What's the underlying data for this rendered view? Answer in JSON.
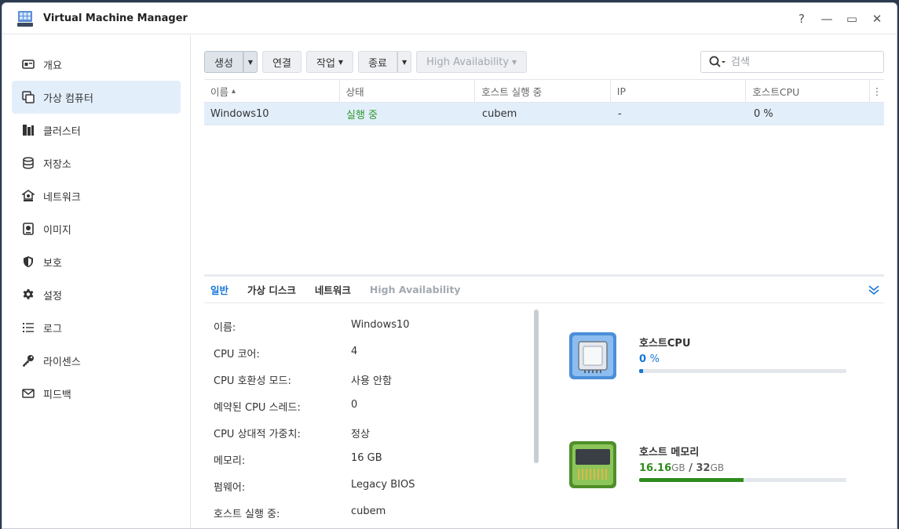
{
  "app": {
    "title": "Virtual Machine Manager"
  },
  "window_controls": {
    "help": "?",
    "minimize": "—",
    "maximize": "▭",
    "close": "✕"
  },
  "sidebar": {
    "items": [
      {
        "label": "개요",
        "icon": "overview-icon"
      },
      {
        "label": "가상 컴퓨터",
        "icon": "virtual-machine-icon",
        "active": true
      },
      {
        "label": "클러스터",
        "icon": "cluster-icon"
      },
      {
        "label": "저장소",
        "icon": "storage-icon"
      },
      {
        "label": "네트워크",
        "icon": "network-icon"
      },
      {
        "label": "이미지",
        "icon": "image-icon"
      },
      {
        "label": "보호",
        "icon": "shield-icon"
      },
      {
        "label": "설정",
        "icon": "gear-icon"
      },
      {
        "label": "로그",
        "icon": "log-list-icon"
      },
      {
        "label": "라이센스",
        "icon": "key-icon"
      },
      {
        "label": "피드백",
        "icon": "mail-icon"
      }
    ]
  },
  "toolbar": {
    "create_label": "생성",
    "connect_label": "연결",
    "action_label": "작업",
    "shutdown_label": "종료",
    "ha_label": "High Availability"
  },
  "search": {
    "placeholder": "검색"
  },
  "grid": {
    "columns": [
      "이름",
      "상태",
      "호스트 실행 중",
      "IP",
      "호스트CPU"
    ],
    "sort_indicator": "▴",
    "more_icon": "⋮",
    "rows": [
      {
        "name": "Windows10",
        "status": "실행 중",
        "host": "cubem",
        "ip": "-",
        "cpu": "0 %"
      }
    ]
  },
  "detail": {
    "tabs": [
      "일반",
      "가상 디스크",
      "네트워크",
      "High Availability"
    ],
    "props": [
      {
        "label": "이름:",
        "value": "Windows10"
      },
      {
        "label": "CPU 코어:",
        "value": "4"
      },
      {
        "label": "CPU 호환성 모드:",
        "value": "사용 안함"
      },
      {
        "label": "예약된 CPU 스레드:",
        "value": "0"
      },
      {
        "label": "CPU 상대적 가중치:",
        "value": "정상"
      },
      {
        "label": "메모리:",
        "value": "16 GB"
      },
      {
        "label": "펌웨어:",
        "value": "Legacy BIOS"
      },
      {
        "label": "호스트 실행 중:",
        "value": "cubem"
      }
    ],
    "host_cpu": {
      "title": "호스트CPU",
      "value": "0",
      "unit": "%",
      "fraction": 0.02,
      "color": "#1677d8"
    },
    "host_memory": {
      "title": "호스트 메모리",
      "used": "16.16",
      "used_unit": "GB",
      "separator": "/",
      "total": "32",
      "total_unit": "GB",
      "fraction": 0.505,
      "color": "#2f8c1e"
    }
  }
}
